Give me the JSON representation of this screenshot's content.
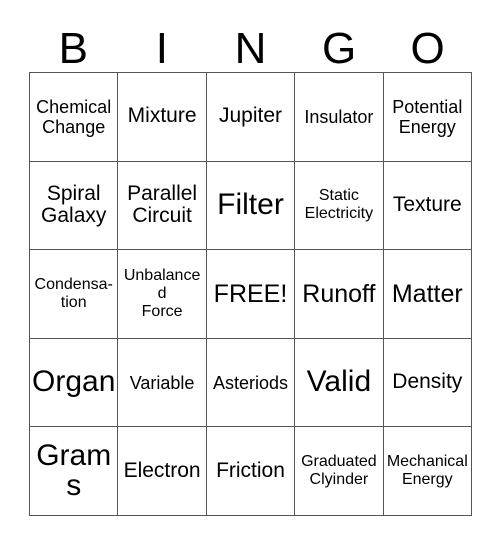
{
  "card": {
    "title": "BINGO",
    "header_letters": [
      "B",
      "I",
      "N",
      "G",
      "O"
    ],
    "columns": 5,
    "rows": 5,
    "free_space_label": "FREE!",
    "free_space_position": {
      "row": 3,
      "column": 3
    },
    "colors": {
      "background": "#ffffff",
      "text": "#000000",
      "grid_line": "#555555"
    },
    "cells": [
      {
        "row": 1,
        "column": 1,
        "letter": "B",
        "text": "Chemical Change",
        "lines": [
          "Chemical",
          "Change"
        ],
        "size": "m",
        "free": false
      },
      {
        "row": 1,
        "column": 2,
        "letter": "I",
        "text": "Mixture",
        "lines": [
          "Mixture"
        ],
        "size": "l",
        "free": false
      },
      {
        "row": 1,
        "column": 3,
        "letter": "N",
        "text": "Jupiter",
        "lines": [
          "Jupiter"
        ],
        "size": "l",
        "free": false
      },
      {
        "row": 1,
        "column": 4,
        "letter": "G",
        "text": "Insulator",
        "lines": [
          "Insulator"
        ],
        "size": "m",
        "free": false
      },
      {
        "row": 1,
        "column": 5,
        "letter": "O",
        "text": "Potential Energy",
        "lines": [
          "Potential",
          "Energy"
        ],
        "size": "m",
        "free": false
      },
      {
        "row": 2,
        "column": 1,
        "letter": "B",
        "text": "Spiral Galaxy",
        "lines": [
          "Spiral",
          "Galaxy"
        ],
        "size": "l",
        "free": false
      },
      {
        "row": 2,
        "column": 2,
        "letter": "I",
        "text": "Parallel Circuit",
        "lines": [
          "Parallel",
          "Circuit"
        ],
        "size": "l",
        "free": false
      },
      {
        "row": 2,
        "column": 3,
        "letter": "N",
        "text": "Filter",
        "lines": [
          "Filter"
        ],
        "size": "xxl",
        "free": false
      },
      {
        "row": 2,
        "column": 4,
        "letter": "G",
        "text": "Static Electricity",
        "lines": [
          "Static",
          "Electricity"
        ],
        "size": "s",
        "free": false
      },
      {
        "row": 2,
        "column": 5,
        "letter": "O",
        "text": "Texture",
        "lines": [
          "Texture"
        ],
        "size": "l",
        "free": false
      },
      {
        "row": 3,
        "column": 1,
        "letter": "B",
        "text": "Condensation",
        "lines": [
          "Condensa-",
          "tion"
        ],
        "size": "s",
        "free": false
      },
      {
        "row": 3,
        "column": 2,
        "letter": "I",
        "text": "Unbalanced Force",
        "lines": [
          "Unbalanced",
          "Force"
        ],
        "size": "s",
        "free": false
      },
      {
        "row": 3,
        "column": 3,
        "letter": "N",
        "text": "FREE!",
        "lines": [
          "FREE!"
        ],
        "size": "xl",
        "free": true
      },
      {
        "row": 3,
        "column": 4,
        "letter": "G",
        "text": "Runoff",
        "lines": [
          "Runoff"
        ],
        "size": "xl",
        "free": false
      },
      {
        "row": 3,
        "column": 5,
        "letter": "O",
        "text": "Matter",
        "lines": [
          "Matter"
        ],
        "size": "xl",
        "free": false
      },
      {
        "row": 4,
        "column": 1,
        "letter": "B",
        "text": "Organ",
        "lines": [
          "Organ"
        ],
        "size": "xxl",
        "free": false
      },
      {
        "row": 4,
        "column": 2,
        "letter": "I",
        "text": "Variable",
        "lines": [
          "Variable"
        ],
        "size": "m",
        "free": false
      },
      {
        "row": 4,
        "column": 3,
        "letter": "N",
        "text": "Asteriods",
        "lines": [
          "Asteriods"
        ],
        "size": "m",
        "free": false
      },
      {
        "row": 4,
        "column": 4,
        "letter": "G",
        "text": "Valid",
        "lines": [
          "Valid"
        ],
        "size": "xxl",
        "free": false
      },
      {
        "row": 4,
        "column": 5,
        "letter": "O",
        "text": "Density",
        "lines": [
          "Density"
        ],
        "size": "l",
        "free": false
      },
      {
        "row": 5,
        "column": 1,
        "letter": "B",
        "text": "Grams",
        "lines": [
          "Grams"
        ],
        "size": "xxl",
        "free": false
      },
      {
        "row": 5,
        "column": 2,
        "letter": "I",
        "text": "Electron",
        "lines": [
          "Electron"
        ],
        "size": "l",
        "free": false
      },
      {
        "row": 5,
        "column": 3,
        "letter": "N",
        "text": "Friction",
        "lines": [
          "Friction"
        ],
        "size": "l",
        "free": false
      },
      {
        "row": 5,
        "column": 4,
        "letter": "G",
        "text": "Graduated Clyinder",
        "lines": [
          "Graduated",
          "Clyinder"
        ],
        "size": "s",
        "free": false
      },
      {
        "row": 5,
        "column": 5,
        "letter": "O",
        "text": "Mechanical Energy",
        "lines": [
          "Mechanical",
          "Energy"
        ],
        "size": "s",
        "free": false
      }
    ]
  }
}
